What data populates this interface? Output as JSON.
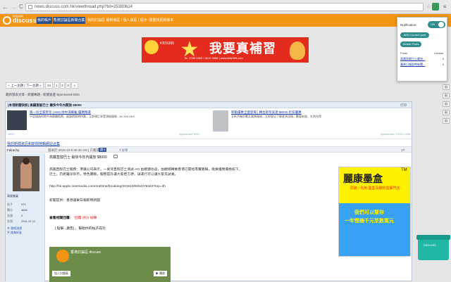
{
  "browser": {
    "url": "news.discuss.com.hk/viewthread.php?tid=25380614",
    "back_glyph": "←",
    "fwd_glyph": "→",
    "reload_glyph": "C",
    "star_glyph": "☆",
    "menu_glyph": "≡"
  },
  "site": {
    "logo_text": "discuss",
    "logo_sub": "香港討論區",
    "nav": [
      "我的帳戶",
      "香港討論區新聞合集"
    ],
    "header_text": "我的討論區 最新版區 / 個人版區 | 提示: 請盡快更新版本"
  },
  "banner": {
    "brand": "KIDS365",
    "headline": "我要真補習",
    "star_glyph": "★",
    "phone": "Tel: 2780 0303 / 9012 3456 | www.kids365.com"
  },
  "pager": {
    "prev": "« 上一主題 | 下一主題 »",
    "pages": [
      "34",
      "1",
      "2",
      "3"
    ],
    "next": "»"
  },
  "breadcrumb": "最新發表文章 › 新聞專題 › 新聞速遞 Sponsored MSC",
  "post": {
    "title_bar": "[本港新聞快訊] 高鐵直駁巴士 最快今年內開放 $8000",
    "title_right": "打印",
    "sponsor_left": {
      "label": "MSC",
      "title": "買一份全家齊享 | MSC地中海郵輪 優惠精選",
      "desc": "不容錯過的地中海郵輪假期，優惠價限時供應，立即預訂享受頂級服務 - 82,345 HKD",
      "site": "Sponsored MSC"
    },
    "sponsor_right": {
      "title": "移動優惠全面登場 | 轉台即享高達 $8000 折扣優惠",
      "desc": "全新手機計劃及寬頻服務，立即登記了解更多詳情，數量有限，先到先得",
      "site": "Sponsored YOOX.COM"
    },
    "thread_link": "我的新聞資訊和新聞特輯網站合集",
    "author": "Falrachy",
    "meta": "發表於 2015-10-5 09:46 AM | 只看該作者",
    "like": "讚 0",
    "share": "f 分享",
    "floor": "1#",
    "print_icon_name": "print-icon",
    "heading": "高鐵直駁巴士 最快今年內開放 $8000",
    "line2": "高鐵直駁巴士服務：港鐵公司表示，一會兒直駁巴士測試 AO 由觀塘往返，由觀塘轉乘香港已開始落實路線，換乘優惠價格如下。",
    "line3": "巴士，仍距離深圳市，特色實驗，服務提升讓大家更方便，試運行可以讓大家先試乘。",
    "url": "http://hk.apple.nextmedia.com/realtime/breaking/20151005/54278343?top=4h",
    "line4": "新聞提供：香港蘋果日報即時新聞",
    "reply_label": "查看相關回覆:",
    "reply_links": "回覆 評分 檢舉",
    "quote": "[ 點擊...廣告] ，幫助你的帖子成功",
    "comic_title": "香港討論區 discuss",
    "comic_btn1": "加入討論區",
    "comic_btn2": "▶ 播放"
  },
  "author_panel": {
    "group": "高級會員",
    "stats": [
      {
        "label": "帖子",
        "value": "570"
      },
      {
        "label": "積分",
        "value": "4660"
      },
      {
        "label": "金錢",
        "value": "0"
      },
      {
        "label": "註冊",
        "value": "2011-12-12"
      }
    ],
    "link_msg": "▣ 發短消息",
    "link_add": "▣ 加為好友"
  },
  "ink_ad": {
    "tm": "TM",
    "title": "麗康墨盒",
    "sub": "原裝 / 代用 墨盒及碳粉盒專門店",
    "line1": "我們可以幫你",
    "line2": "一年慳幾千元至數萬元"
  },
  "extension": {
    "notif_label": "Notification:",
    "toggle_text": "ON",
    "add_btn": "ADD Current post",
    "del_btn": "Delete Posts",
    "col_posts": "Posts",
    "col_unread": "Unread",
    "rows": [
      {
        "title": "高鐵直駁巴士最快...",
        "count": "0"
      },
      {
        "title": "蘋果日報即時新聞...",
        "count": "0"
      }
    ]
  },
  "side_icons": [
    "▤",
    "▤",
    "▤",
    "▤",
    "▤"
  ],
  "cart_label": "DISCUSS",
  "colors": {
    "brand_orange": "#f39412",
    "nav_blue": "#2b4f8b",
    "ext_teal": "#2f8e8d",
    "cart_teal": "#20b7a6"
  }
}
